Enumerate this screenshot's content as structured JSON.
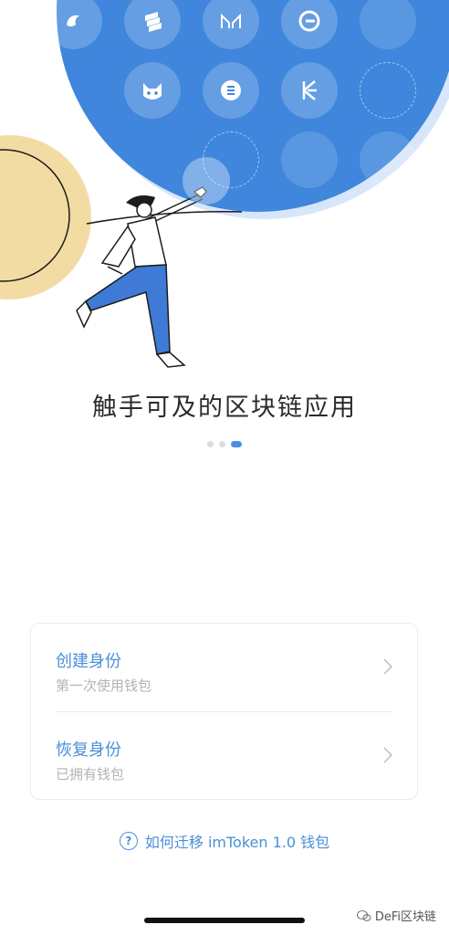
{
  "hero": {
    "apps": [
      {
        "name": "swirl-icon"
      },
      {
        "name": "stack-icon"
      },
      {
        "name": "maker-icon"
      },
      {
        "name": "e-logo-icon"
      },
      {
        "name": "placeholder-icon"
      },
      {
        "name": "cat-icon"
      },
      {
        "name": "flower-icon"
      },
      {
        "name": "kyber-icon"
      },
      {
        "name": "dashed-slot-icon"
      }
    ]
  },
  "headline": "触手可及的区块链应用",
  "pager": {
    "count": 3,
    "active_index": 2
  },
  "options": [
    {
      "title": "创建身份",
      "subtitle": "第一次使用钱包"
    },
    {
      "title": "恢复身份",
      "subtitle": "已拥有钱包"
    }
  ],
  "migrate": {
    "icon": "?",
    "label": "如何迁移 imToken 1.0 钱包"
  },
  "watermark": {
    "text": "DeFi区块链"
  },
  "colors": {
    "brand_blue": "#3f86dc",
    "accent_text": "#4a8fd9",
    "sand": "#f3dba4"
  }
}
